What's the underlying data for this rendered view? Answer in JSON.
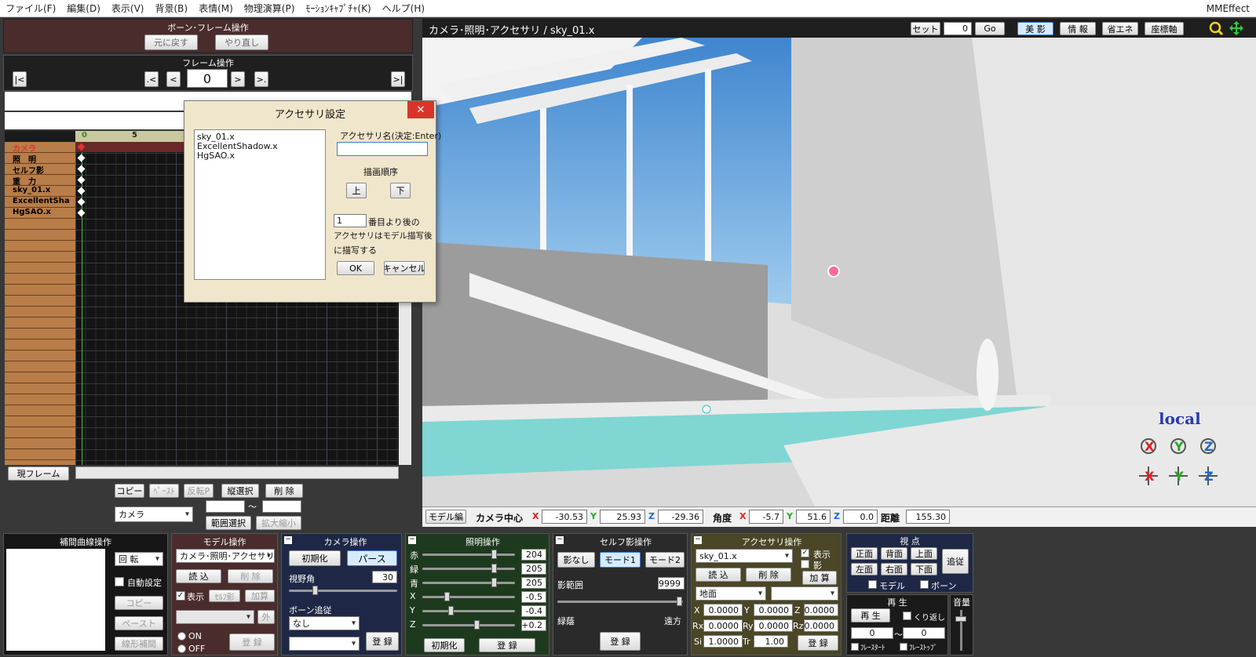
{
  "app": {
    "name": "MMEffect"
  },
  "menu": [
    "ファイル(F)",
    "編集(D)",
    "表示(V)",
    "背景(B)",
    "表情(M)",
    "物理演算(P)",
    "ﾓｰｼｮﾝｷｬﾌﾟﾁｬ(K)",
    "ヘルプ(H)"
  ],
  "bone_panel": {
    "title": "ボーン･フレーム操作",
    "undo": "元に戻す",
    "redo": "やり直し"
  },
  "frame_panel": {
    "title": "フレーム操作",
    "first": "|<",
    "prev_key": ".<",
    "prev": "<",
    "frame": "0",
    "next": ">",
    "next_key": ">.",
    "last": ">|"
  },
  "timeline": {
    "tick_labels": [
      "0",
      "5"
    ],
    "rows": [
      "カメラ",
      "照　明",
      "セルフ影",
      "重　力",
      "sky_01.x",
      "ExcellentSha",
      "HgSAO.x"
    ],
    "current_frame_button": "現フレーム",
    "copy": "コピー",
    "paste": "ﾍﾟｰｽﾄ",
    "reverse": "反転P",
    "vertical_select": "縦選択",
    "delete": "削 除",
    "target": "カメラ",
    "range_sep": "～",
    "range_select": "範囲選択",
    "scale": "拡大縮小"
  },
  "dialog": {
    "title": "アクセサリ設定",
    "close": "✕",
    "list": [
      "sky_01.x",
      "ExcellentShadow.x",
      "HgSAO.x"
    ],
    "name_label": "アクセサリ名(決定:Enter)",
    "name_value": "",
    "order_label": "描画順序",
    "up": "上",
    "down": "下",
    "order_value": "1",
    "order_text_1": "番目より後の",
    "order_text_2": "アクセサリはモデル描写後",
    "order_text_3": "に描写する",
    "ok": "OK",
    "cancel": "キャンセル"
  },
  "viewport": {
    "title": "カメラ･照明･アクセサリ / sky_01.x",
    "set_label": "セット",
    "set_value": "0",
    "go": "Go",
    "toggles": [
      "美 影",
      "情 報",
      "省エネ",
      "座標軸"
    ],
    "local_label": "local",
    "model_edit": "モデル編",
    "cam_center_label": "カメラ中心",
    "cx": "-30.53",
    "cy": "25.93",
    "cz": "-29.36",
    "angle_label": "角度",
    "ax": "-5.7",
    "ay": "51.6",
    "az": "0.0",
    "dist_label": "距離",
    "dist": "155.30",
    "x": "X",
    "y": "Y",
    "z": "Z"
  },
  "interp": {
    "title": "補間曲線操作",
    "rotate": "回 転",
    "auto": "自動設定",
    "copy": "コピー",
    "paste": "ペースト",
    "linear": "線形補間"
  },
  "model_op": {
    "title": "モデル操作",
    "model": "カメラ･照明･アクセサリ",
    "load": "読 込",
    "delete": "削 除",
    "display": "表示",
    "self_shadow": "ｾﾙﾌ影",
    "add": "加算",
    "outer": "外",
    "on": "ON",
    "off": "OFF",
    "register": "登 録"
  },
  "camera_op": {
    "title": "カメラ操作",
    "init": "初期化",
    "perspective": "パース",
    "fov_label": "視野角",
    "fov": "30",
    "bone_follow": "ボーン追従",
    "follow_value": "なし",
    "register": "登 録"
  },
  "light_op": {
    "title": "照明操作",
    "labels": [
      "赤",
      "緑",
      "青",
      "X",
      "Y",
      "Z"
    ],
    "values": [
      "204",
      "205",
      "205",
      "-0.5",
      "-0.4",
      "+0.2"
    ],
    "levels": [
      0.8,
      0.8,
      0.8,
      0.25,
      0.3,
      0.6
    ],
    "init": "初期化",
    "register": "登 録"
  },
  "self_shadow_op": {
    "title": "セルフ影操作",
    "none": "影なし",
    "mode1": "モード1",
    "mode2": "モード2",
    "range_label": "影範囲",
    "range": "9999",
    "near": "緑蔭",
    "far": "遠方",
    "register": "登 録"
  },
  "acc_op": {
    "title": "アクセサリ操作",
    "acc": "sky_01.x",
    "display": "表示",
    "shadow": "影",
    "load": "読 込",
    "delete": "削 除",
    "add": "加 算",
    "parent": "地面",
    "register": "登 録",
    "x": "0.0000",
    "y": "0.0000",
    "z": "0.0000",
    "rx": "0.0000",
    "ry": "0.0000",
    "rz": "0.0000",
    "si": "1.0000",
    "tr": "1.00"
  },
  "view_op": {
    "title": "視 点",
    "front": "正面",
    "back": "背面",
    "top": "上面",
    "left": "左面",
    "right": "右面",
    "bottom": "下面",
    "follow": "追従",
    "model": "モデル",
    "bone": "ボーン"
  },
  "play_op": {
    "title": "再 生",
    "play": "再 生",
    "repeat": "くり返し",
    "from": "0",
    "to": "0",
    "sep": "～",
    "frame_start": "ﾌﾚｰｽﾀｰﾄ",
    "frame_stop": "ﾌﾚｰｽﾄｯﾌﾟ"
  },
  "volume": {
    "title": "音量"
  },
  "colors": {
    "accent": "#3c7fd8",
    "panel_dark": "#1b1b1b",
    "bone_header": "#4a2c2c"
  }
}
